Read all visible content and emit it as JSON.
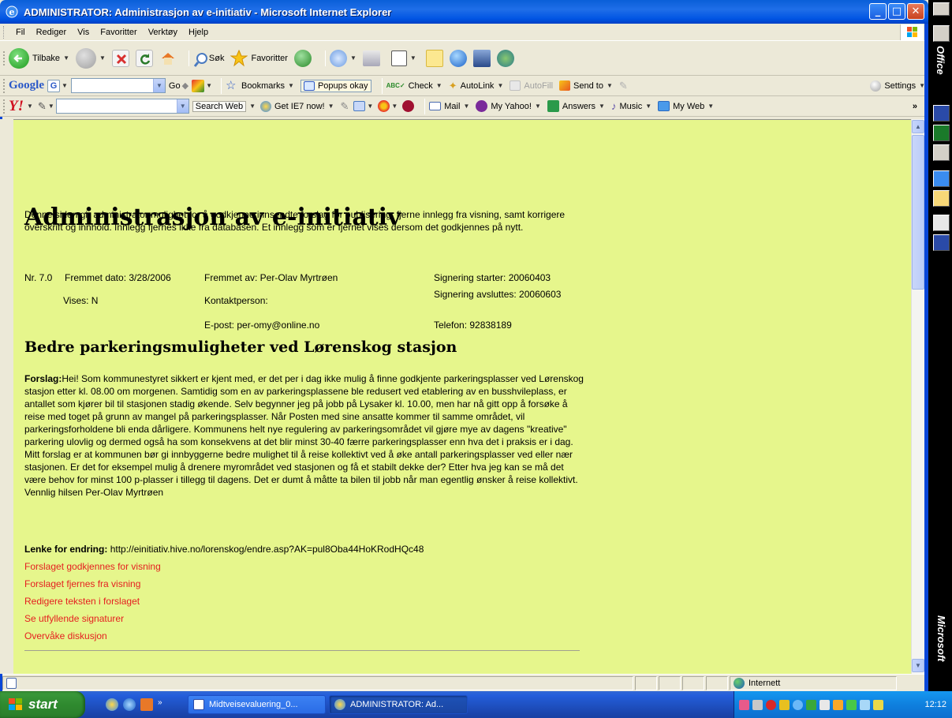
{
  "window": {
    "title": "ADMINISTRATOR: Administrasjon av e-initiativ - Microsoft Internet Explorer",
    "controls": {
      "minimize": "_",
      "maximize": "□",
      "close": "✕"
    }
  },
  "menubar": {
    "items": [
      "Fil",
      "Rediger",
      "Vis",
      "Favoritter",
      "Verktøy",
      "Hjelp"
    ]
  },
  "toolbar": {
    "back": "Tilbake",
    "search": "Søk",
    "favorites": "Favoritter"
  },
  "google_toolbar": {
    "brand": "Google",
    "go": "Go",
    "bookmarks": "Bookmarks",
    "popups": "Popups okay",
    "check": "Check",
    "autolink": "AutoLink",
    "autofill": "AutoFill",
    "send_to": "Send to",
    "settings": "Settings"
  },
  "yahoo_toolbar": {
    "brand": "Y!",
    "search_web": "Search Web",
    "get_ie7": "Get IE7 now!",
    "mail": "Mail",
    "my_yahoo": "My Yahoo!",
    "answers": "Answers",
    "music": "Music",
    "my_web": "My Web",
    "more": "»"
  },
  "page": {
    "title": "Administrasjon av e-initiativ",
    "intro": "Denne siden gir administrator mulighet for å godkjenne innsendte forslag for publisering, fjerne innlegg fra visning, samt korrigere overskrift og innhold. Innlegg fjernes ikke fra databasen. Et innlegg som er fjernet vises dersom det godkjennes på nytt.",
    "meta": {
      "nr": "Nr. 7.0",
      "fremmet_dato": "Fremmet dato: 3/28/2006",
      "fremmet_av": "Fremmet av: Per-Olav Myrtrøen",
      "signering_starter": "Signering starter: 20060403",
      "vises": "Vises: N",
      "kontaktperson": "Kontaktperson:",
      "signering_avsluttes": "Signering avsluttes: 20060603",
      "epost": "E-post: per-omy@online.no",
      "telefon": "Telefon: 92838189"
    },
    "proposal_title": "Bedre parkeringsmuligheter ved Lørenskog stasjon",
    "forslag_label": "Forslag:",
    "forslag_text": "Hei! Som kommunestyret sikkert er kjent med, er det per i dag ikke mulig å finne godkjente parkeringsplasser ved Lørenskog stasjon etter kl. 08.00 om morgenen. Samtidig som en av parkeringsplassene ble redusert ved etablering av en busshvileplass, er antallet som kjører bil til stasjonen stadig økende. Selv begynner jeg på jobb på Lysaker kl. 10.00, men har nå gitt opp å forsøke å reise med toget på grunn av mangel på parkeringsplasser. Når Posten med sine ansatte kommer til samme området, vil parkeringsforholdene bli enda dårligere. Kommunens helt nye regulering av parkeringsområdet vil gjøre mye av dagens \"kreative\" parkering ulovlig og dermed også ha som konsekvens at det blir minst 30-40 færre parkeringsplasser enn hva det i praksis er i dag. Mitt forslag er at kommunen bør gi innbyggerne bedre mulighet til å reise kollektivt ved å øke antall parkeringsplasser ved eller nær stasjonen. Er det for eksempel mulig å drenere myrområdet ved stasjonen og få et stabilt dekke der? Etter hva jeg kan se må det være behov for minst 100 p-plasser i tillegg til dagens. Det er dumt å måtte ta bilen til jobb når man egentlig ønsker å reise kollektivt. Vennlig hilsen Per-Olav Myrtrøen",
    "lenke_label": "Lenke for endring:",
    "lenke_url": "http://einitiativ.hive.no/lorenskog/endre.asp?AK=pul8Oba44HoKRodHQc48",
    "actions": [
      "Forslaget godkjennes for visning",
      "Forslaget fjernes fra visning",
      "Redigere teksten i forslaget",
      "Se utfyllende signaturer",
      "Overvåke diskusjon"
    ],
    "link_color": "#e52020",
    "background": "#e6f68c"
  },
  "statusbar": {
    "zone": "Internett"
  },
  "taskbar": {
    "start": "start",
    "tasks": [
      {
        "label": "Midtveisevaluering_0..."
      },
      {
        "label": "ADMINISTRATOR: Ad..."
      }
    ],
    "clock": "12:12"
  },
  "office_bar": {
    "top_label": "Office",
    "bottom_label": "Microsoft"
  }
}
